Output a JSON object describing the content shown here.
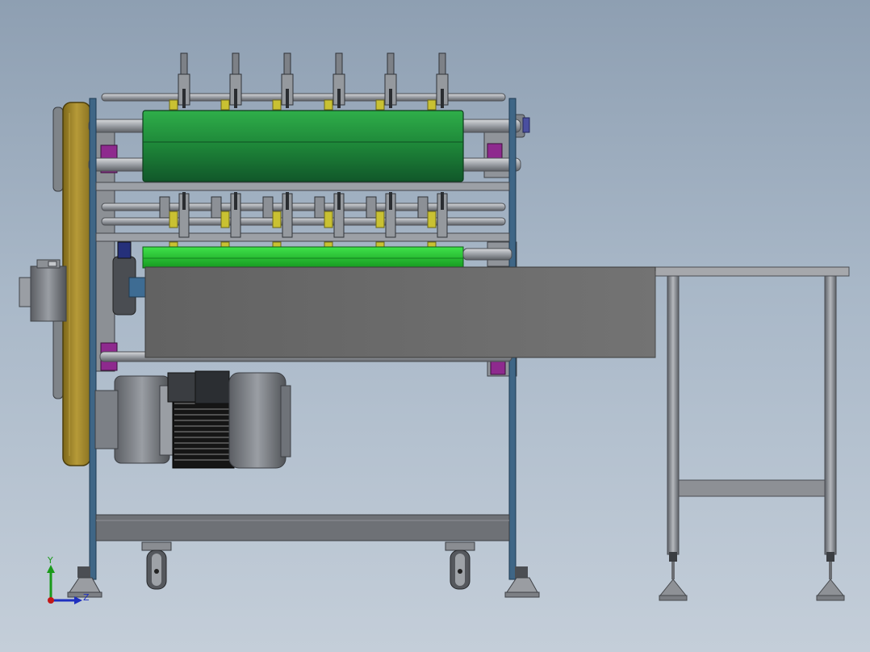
{
  "view": {
    "type": "cad-assembly-front-view",
    "background_top": "#8e9fb2",
    "background_bottom": "#c4ced9"
  },
  "colors": {
    "frame_blue": "#3f6686",
    "roller_green_dark": "#1f8a3a",
    "roller_green_light": "#1fc22a",
    "belt_guard_gold": "#a58a2e",
    "clamp_yellow": "#c9c132",
    "bearing_magenta": "#8e2a8e",
    "sheet_gray": "#6b6b6b",
    "motor_black": "#151515",
    "steel_gray": "#8a8d92"
  },
  "triad": {
    "x_label": "",
    "y_label": "Y",
    "z_label": "Z"
  }
}
